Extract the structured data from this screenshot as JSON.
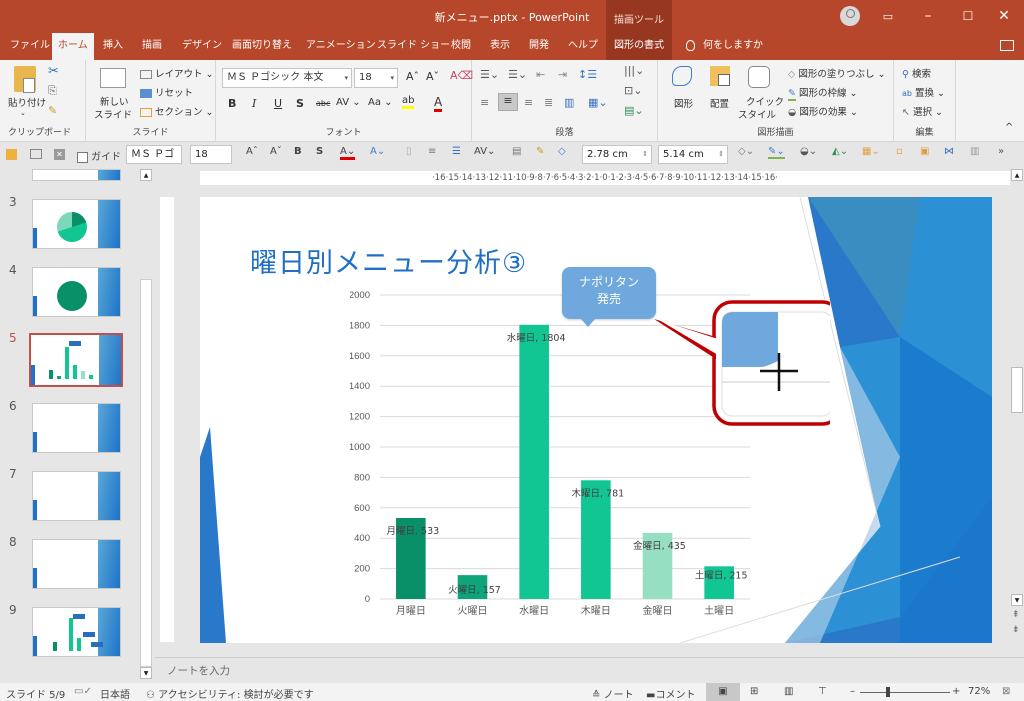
{
  "window": {
    "title": "新メニュー.pptx  -  PowerPoint",
    "context_tab_group": "描画ツール",
    "controls": {
      "minimize": "–",
      "maximize": "☐",
      "close": "✕",
      "ribbon_display": "▭"
    }
  },
  "tabs": [
    {
      "label": "ファイル"
    },
    {
      "label": "ホーム",
      "active": true
    },
    {
      "label": "挿入"
    },
    {
      "label": "描画"
    },
    {
      "label": "デザイン"
    },
    {
      "label": "画面切り替え"
    },
    {
      "label": "アニメーション"
    },
    {
      "label": "スライド ショー"
    },
    {
      "label": "校閲"
    },
    {
      "label": "表示"
    },
    {
      "label": "開発"
    },
    {
      "label": "ヘルプ"
    },
    {
      "label": "図形の書式",
      "context": true
    }
  ],
  "tell_me": "何をしますか",
  "ribbon": {
    "clipboard": {
      "label": "クリップボード",
      "paste": "貼り付け"
    },
    "slides": {
      "label": "スライド",
      "new_slide_1": "新しい",
      "new_slide_2": "スライド",
      "layout": "レイアウト",
      "reset": "リセット",
      "section": "セクション"
    },
    "font": {
      "label": "フォント",
      "font_name": "ＭＳ Ｐゴシック 本文",
      "font_size": "18"
    },
    "paragraph": {
      "label": "段落"
    },
    "drawing": {
      "label": "図形描画",
      "shapes": "図形",
      "arrange": "配置",
      "quick_style_1": "クイック",
      "quick_style_2": "スタイル",
      "fill": "図形の塗りつぶし",
      "outline": "図形の枠線",
      "effects": "図形の効果"
    },
    "editing": {
      "label": "編集",
      "find": "検索",
      "replace": "置換",
      "select": "選択"
    }
  },
  "mini_toolbar": {
    "guide_label": "ガイド",
    "font_name": "ＭＳ Ｐゴ",
    "font_size": "18",
    "height": "2.78 cm",
    "width": "5.14 cm"
  },
  "ruler": {
    "marks": "·16·15·14·13·12·11·10·9·8·7·6·5·4·3·2·1·0·1·2·3·4·5·6·7·8·9·10·11·12·13·14·15·16·"
  },
  "thumbnails": [
    {
      "num": "3",
      "kind": "pie"
    },
    {
      "num": "4",
      "kind": "pie-single"
    },
    {
      "num": "5",
      "kind": "bar",
      "selected": true
    },
    {
      "num": "6",
      "kind": "blank"
    },
    {
      "num": "7",
      "kind": "blank"
    },
    {
      "num": "8",
      "kind": "blank"
    },
    {
      "num": "9",
      "kind": "bar-callouts"
    }
  ],
  "slide": {
    "title": "曜日別メニュー分析③",
    "callout": {
      "line1": "ナポリタン",
      "line2": "発売"
    }
  },
  "chart_data": {
    "type": "bar",
    "title": "",
    "categories": [
      "月曜日",
      "火曜日",
      "水曜日",
      "木曜日",
      "金曜日",
      "土曜日"
    ],
    "values": [
      533,
      157,
      1804,
      781,
      435,
      215
    ],
    "data_labels": [
      "月曜日, 533",
      "火曜日, 157",
      "水曜日, 1804",
      "木曜日, 781",
      "金曜日, 435",
      "土曜日, 215"
    ],
    "colors": [
      "#0a9068",
      "#0ea57a",
      "#12c693",
      "#12c693",
      "#96dfc3",
      "#12c693"
    ],
    "ylim": [
      0,
      2000
    ],
    "yticks": [
      0,
      200,
      400,
      600,
      800,
      1000,
      1200,
      1400,
      1600,
      1800,
      2000
    ],
    "grid": true,
    "xlabel": "",
    "ylabel": ""
  },
  "notes": {
    "placeholder": "ノートを入力"
  },
  "status": {
    "slide": "スライド 5/9",
    "language": "日本語",
    "accessibility": "アクセシビリティ: 検討が必要です",
    "notes": "ノート",
    "comments": "コメント",
    "zoom": "72%"
  },
  "colors": {
    "accent": "#b7472a",
    "title_blue": "#1f6fc5",
    "callout": "#6fa8dc",
    "highlight_red": "#c00000"
  }
}
